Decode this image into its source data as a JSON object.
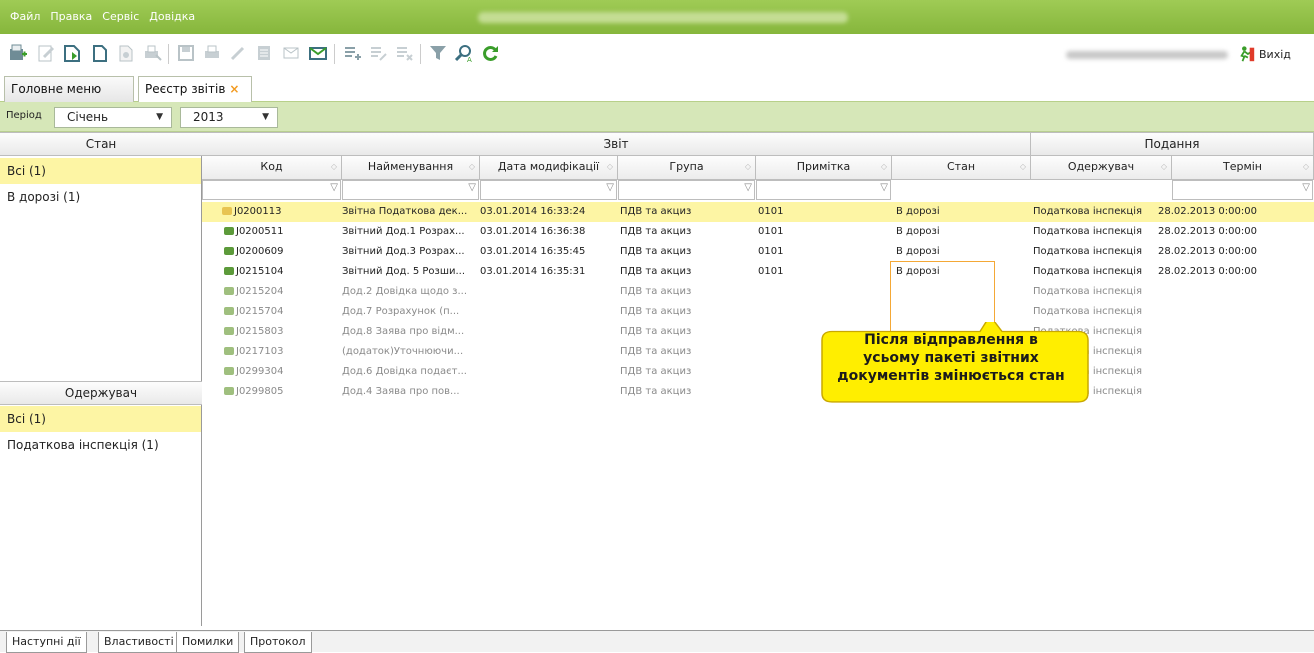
{
  "menu": [
    "Файл",
    "Правка",
    "Сервіс",
    "Довідка"
  ],
  "toolbar": {
    "exit_label": "Вихід"
  },
  "tabs": [
    {
      "label": "Головне меню"
    },
    {
      "label": "Реєстр звітів",
      "close": "×"
    }
  ],
  "period": {
    "label": "Період",
    "month": "Січень",
    "year": "2013"
  },
  "state_panel": {
    "title": "Стан",
    "items": [
      "Всі (1)",
      "В дорозі (1)"
    ]
  },
  "recipient_panel": {
    "title": "Одержувач",
    "items": [
      "Всі (1)",
      "Податкова інспекція (1)"
    ]
  },
  "grid": {
    "group_headers": {
      "report": "Звіт",
      "submission": "Подання"
    },
    "columns": [
      "Код",
      "Найменування",
      "Дата модифікації",
      "Група",
      "Примітка",
      "Стан",
      "Одержувач",
      "Термін"
    ],
    "rows": [
      [
        "J0200113",
        "Звітна Податкова дек...",
        "03.01.2014 16:33:24",
        "ПДВ та акциз",
        "0101",
        "В дорозі",
        "Податкова інспекція",
        "28.02.2013 0:00:00"
      ],
      [
        "J0200511",
        "Звітний Дод.1 Розрах...",
        "03.01.2014 16:36:38",
        "ПДВ та акциз",
        "0101",
        "В дорозі",
        "Податкова інспекція",
        "28.02.2013 0:00:00"
      ],
      [
        "J0200609",
        "Звітний Дод.3 Розрах...",
        "03.01.2014 16:35:45",
        "ПДВ та акциз",
        "0101",
        "В дорозі",
        "Податкова інспекція",
        "28.02.2013 0:00:00"
      ],
      [
        "J0215104",
        "Звітний Дод. 5 Розши...",
        "03.01.2014 16:35:31",
        "ПДВ та акциз",
        "0101",
        "В дорозі",
        "Податкова інспекція",
        "28.02.2013 0:00:00"
      ],
      [
        "J0215204",
        "Дод.2 Довідка щодо з...",
        "",
        "ПДВ та акциз",
        "",
        "",
        "Податкова інспекція",
        ""
      ],
      [
        "J0215704",
        "Дод.7 Розрахунок (п...",
        "",
        "ПДВ та акциз",
        "",
        "",
        "Податкова інспекція",
        ""
      ],
      [
        "J0215803",
        "Дод.8 Заява про відм...",
        "",
        "ПДВ та акциз",
        "",
        "",
        "Податкова інспекція",
        ""
      ],
      [
        "J0217103",
        "(додаток)Уточнюючи...",
        "",
        "ПДВ та акциз",
        "",
        "",
        "Податкова інспекція",
        ""
      ],
      [
        "J0299304",
        "Дод.6 Довідка подаєт...",
        "",
        "ПДВ та акциз",
        "",
        "",
        "Податкова інспекція",
        ""
      ],
      [
        "J0299805",
        "Дод.4 Заява про пов...",
        "",
        "ПДВ та акциз",
        "",
        "",
        "Податкова інспекція",
        ""
      ]
    ]
  },
  "callout": {
    "line1": "Після відправлення в",
    "line2": "усьому пакеті звітних",
    "line3": "документів змінюється стан"
  },
  "bottom_tabs": [
    "Наступні дії",
    "Властивості",
    "Помилки",
    "Протокол"
  ],
  "colors": {
    "accent": "#8fbe48",
    "selection": "#fdf5a4",
    "callout": "#ffee00",
    "highlight": "#f4a836"
  }
}
